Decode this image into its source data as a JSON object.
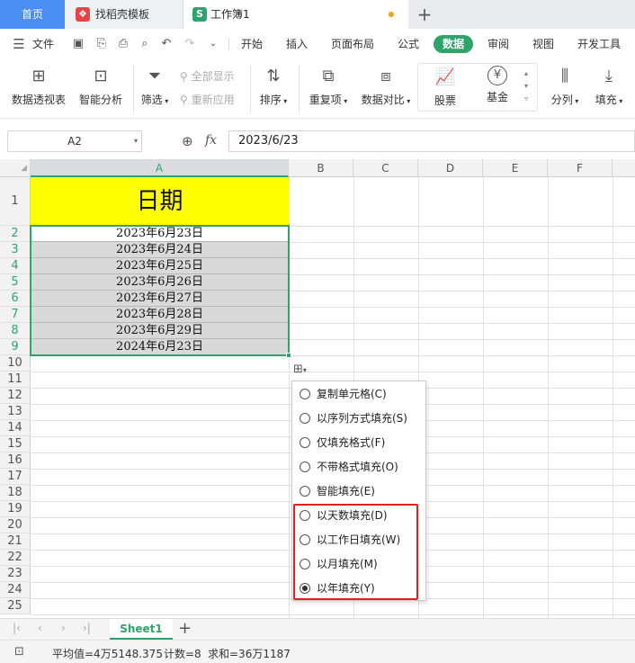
{
  "tabs": {
    "home": "首页",
    "template": "找稻壳模板",
    "workbook": "工作簿1",
    "wps_letter": "S",
    "plus": "+"
  },
  "menu": {
    "file": "文件",
    "items": [
      "开始",
      "插入",
      "页面布局",
      "公式",
      "数据",
      "审阅",
      "视图",
      "开发工具"
    ]
  },
  "ribbon": {
    "pivot": "数据透视表",
    "smart_analysis": "智能分析",
    "filter": "筛选",
    "show_all": "全部显示",
    "reapply": "重新应用",
    "sort": "排序",
    "duplicates": "重复项",
    "compare": "数据对比",
    "stock": "股票",
    "fund": "基金",
    "split": "分列",
    "fill": "填充"
  },
  "formula_bar": {
    "name_box": "A2",
    "fx": "fx",
    "value": "2023/6/23"
  },
  "columns": [
    "A",
    "B",
    "C",
    "D",
    "E",
    "F"
  ],
  "rows": [
    "1",
    "2",
    "3",
    "4",
    "5",
    "6",
    "7",
    "8",
    "9",
    "10",
    "11",
    "12",
    "13",
    "14",
    "15",
    "16",
    "17",
    "18",
    "19",
    "20",
    "21",
    "22",
    "23",
    "24",
    "25"
  ],
  "cells": {
    "a1": "日期",
    "dates": [
      "2023年6月23日",
      "2023年6月24日",
      "2023年6月25日",
      "2023年6月26日",
      "2023年6月27日",
      "2023年6月28日",
      "2023年6月29日",
      "2024年6月23日"
    ]
  },
  "fill_options": {
    "items": [
      "复制单元格(C)",
      "以序列方式填充(S)",
      "仅填充格式(F)",
      "不带格式填充(O)",
      "智能填充(E)",
      "以天数填充(D)",
      "以工作日填充(W)",
      "以月填充(M)",
      "以年填充(Y)"
    ],
    "selected_index": 8
  },
  "sheet": {
    "name": "Sheet1"
  },
  "status": {
    "average": "平均值=4万5148.375",
    "count": "计数=8",
    "sum": "求和=36万1187"
  },
  "colors": {
    "accent_green": "#2ea36b",
    "home_tab_blue": "#4b8ef2",
    "header_yellow": "#ffff00",
    "selected_gray": "#d9d9d9",
    "highlight_red": "#e02020"
  }
}
